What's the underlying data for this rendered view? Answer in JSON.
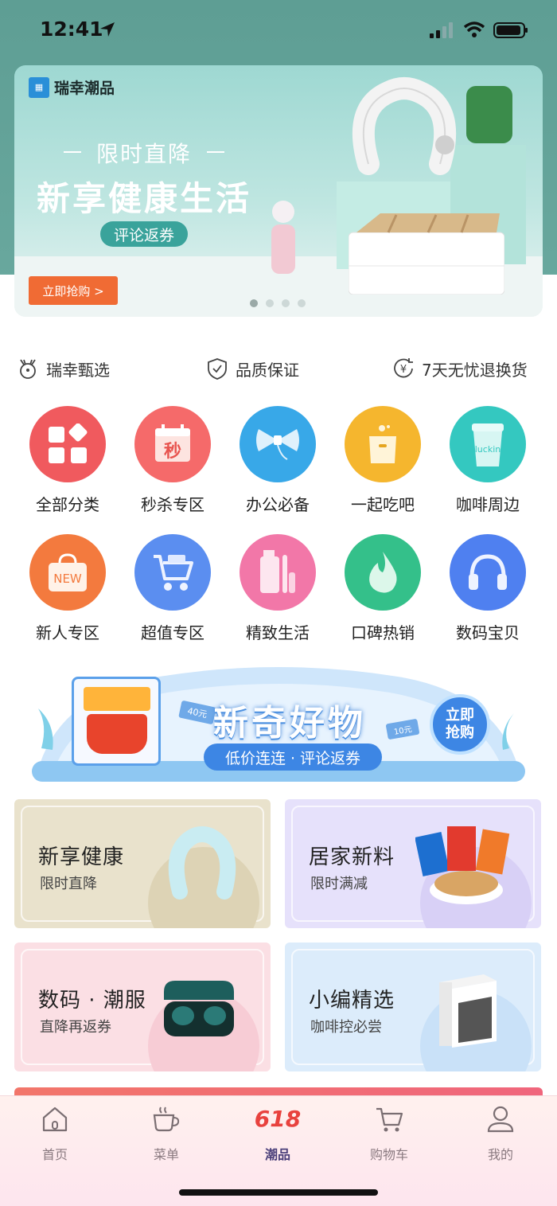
{
  "status_bar": {
    "time": "12:41"
  },
  "banner": {
    "brand": "瑞幸潮品",
    "subtitle": "限时直降",
    "title": "新享健康生活",
    "pill": "评论返券",
    "cta": "立即抢购 >",
    "slide_count": 4,
    "active_slide": 1
  },
  "trust": [
    {
      "icon": "deer-icon",
      "label": "瑞幸甄选"
    },
    {
      "icon": "shield-check-icon",
      "label": "品质保证"
    },
    {
      "icon": "yen-return-icon",
      "label": "7天无忧退换货"
    }
  ],
  "categories": [
    {
      "label": "全部分类",
      "icon": "grid-icon",
      "color": "#f05a5e"
    },
    {
      "label": "秒杀专区",
      "icon": "calendar-icon",
      "color": "#f56a6a",
      "icon_text": "秒"
    },
    {
      "label": "办公必备",
      "icon": "bow-icon",
      "color": "#38a8e8"
    },
    {
      "label": "一起吃吧",
      "icon": "bag-icon",
      "color": "#f5b62e"
    },
    {
      "label": "咖啡周边",
      "icon": "cup-icon",
      "color": "#34c8c0",
      "icon_text": "luckin"
    },
    {
      "label": "新人专区",
      "icon": "new-bag-icon",
      "color": "#f37a3e",
      "icon_text": "NEW"
    },
    {
      "label": "超值专区",
      "icon": "cart-icon",
      "color": "#5b8ef0"
    },
    {
      "label": "精致生活",
      "icon": "bottles-icon",
      "color": "#f277a8"
    },
    {
      "label": "口碑热销",
      "icon": "flame-icon",
      "color": "#34c08a"
    },
    {
      "label": "数码宝贝",
      "icon": "headphones-icon",
      "color": "#4f80f0"
    }
  ],
  "promo": {
    "title": "新奇好物",
    "subtitle": "低价连连 · 评论返券",
    "cta_line1": "立即",
    "cta_line2": "抢购",
    "price_tag_1": "40元",
    "price_tag_2": "10元"
  },
  "cards": [
    {
      "title": "新享健康",
      "subtitle": "限时直降",
      "bg": "#e9e2cc"
    },
    {
      "title": "居家新料",
      "subtitle": "限时满减",
      "bg": "#e6e1fb"
    },
    {
      "title": "数码 · 潮服",
      "subtitle": "直降再返券",
      "bg": "#fbdfe4"
    },
    {
      "title": "小编精选",
      "subtitle": "咖啡控必尝",
      "bg": "#dcecfb"
    }
  ],
  "tabbar": {
    "items": [
      {
        "label": "首页",
        "icon": "home-icon"
      },
      {
        "label": "菜单",
        "icon": "coffee-cup-icon"
      },
      {
        "label": "潮品",
        "icon": "618-icon",
        "badge": "618",
        "active": true
      },
      {
        "label": "购物车",
        "icon": "cart-icon"
      },
      {
        "label": "我的",
        "icon": "user-icon"
      }
    ]
  },
  "colors": {
    "accent": "#f06b34",
    "teal": "#5e9e94",
    "active_tab": "#4a3f7a"
  }
}
